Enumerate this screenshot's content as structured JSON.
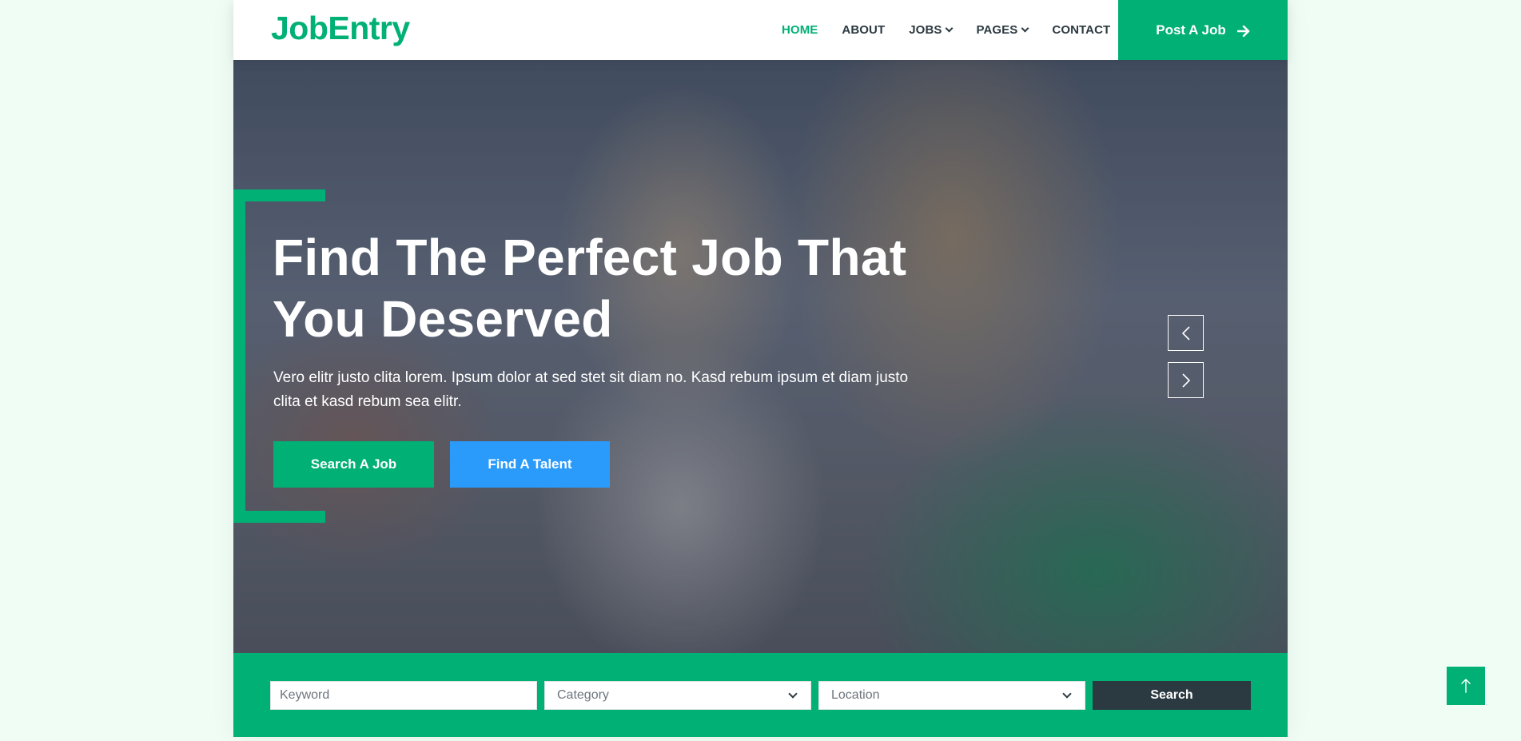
{
  "brand": {
    "name": "JobEntry"
  },
  "nav": {
    "items": [
      {
        "label": "HOME"
      },
      {
        "label": "ABOUT"
      },
      {
        "label": "JOBS"
      },
      {
        "label": "PAGES"
      },
      {
        "label": "CONTACT"
      }
    ],
    "cta_label": "Post A Job"
  },
  "hero": {
    "title": "Find The Perfect Job That You Deserved",
    "text": "Vero elitr justo clita lorem. Ipsum dolor at sed stet sit diam no. Kasd rebum ipsum et diam justo clita et kasd rebum sea elitr.",
    "primary_button": "Search A Job",
    "secondary_button": "Find A Talent"
  },
  "search": {
    "keyword_placeholder": "Keyword",
    "category_selected": "Category",
    "location_selected": "Location",
    "button_label": "Search"
  },
  "colors": {
    "accent": "#00b074",
    "secondary": "#2a9bfb",
    "dark": "#2b3940",
    "page_bg": "#effdf5"
  },
  "icons": {
    "post_job": "arrow-right-icon",
    "carousel_prev": "chevron-left-icon",
    "carousel_next": "chevron-right-icon",
    "back_to_top": "arrow-up-icon"
  }
}
